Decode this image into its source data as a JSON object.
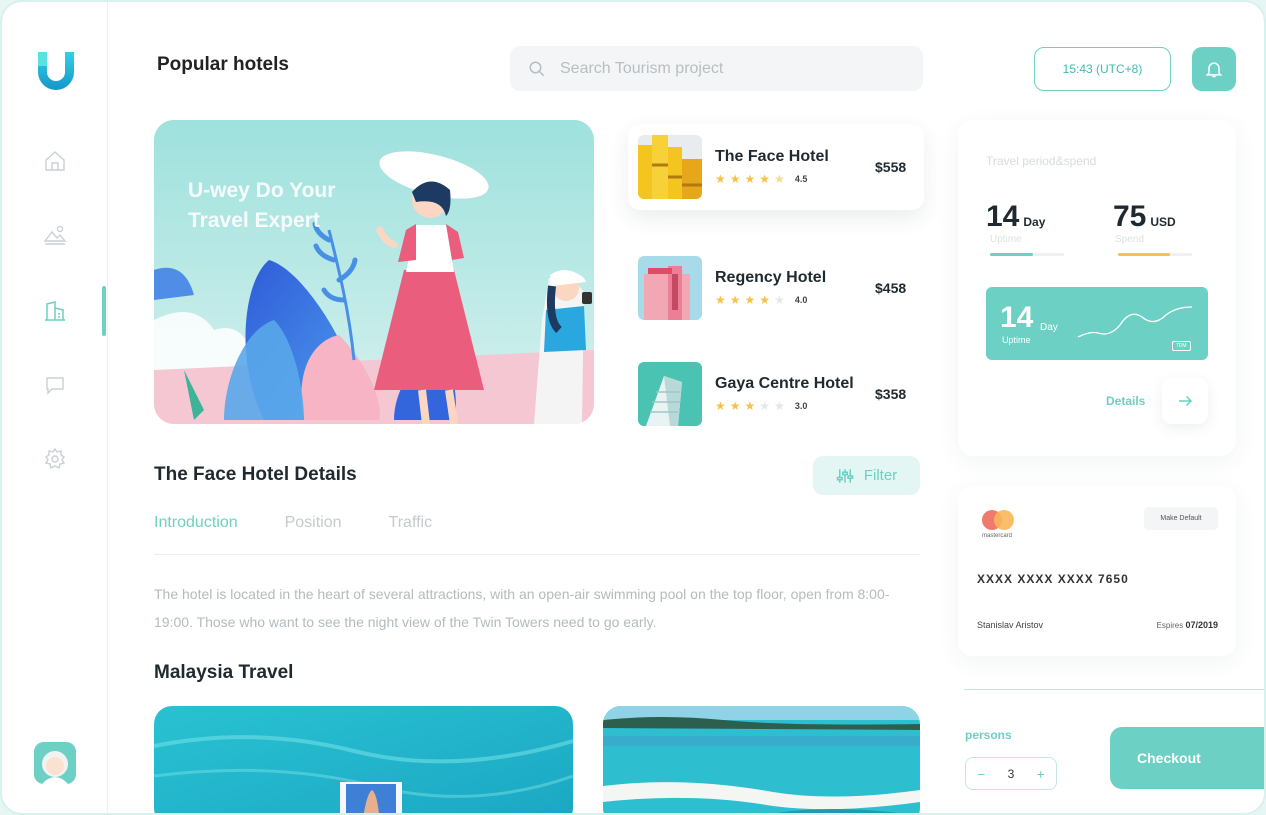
{
  "header": {
    "title": "Popular hotels",
    "search_placeholder": "Search Tourism project",
    "time": "15:43  (UTC+8)"
  },
  "sidebar": {
    "items": [
      {
        "icon": "home-icon"
      },
      {
        "icon": "landscape-icon"
      },
      {
        "icon": "hotel-icon",
        "active": true
      },
      {
        "icon": "chat-icon"
      },
      {
        "icon": "settings-icon"
      }
    ],
    "accent": "#6dd0c4"
  },
  "hero": {
    "headline": "U-wey Do Your Travel Expert"
  },
  "hotels": [
    {
      "name": "The Face Hotel",
      "rating": 4.5,
      "rating_label": "4.5",
      "price": "$558"
    },
    {
      "name": "Regency Hotel",
      "rating": 4.0,
      "rating_label": "4.0",
      "price": "$458"
    },
    {
      "name": "Gaya Centre Hotel",
      "rating": 3.0,
      "rating_label": "3.0",
      "price": "$358"
    }
  ],
  "details": {
    "title": "The Face Hotel Details",
    "filter_label": "Filter",
    "tabs": [
      "Introduction",
      "Position",
      "Traffic"
    ],
    "active_tab": 0,
    "description": "The hotel is located in the heart of several attractions, with an open-air swimming pool on the top floor, open from 8:00-19:00. Those who want to see the night view of the Twin Towers need to go early."
  },
  "travel": {
    "title": "Malaysia Travel"
  },
  "stats": {
    "title": "Travel period&spend",
    "uptime_value": "14",
    "uptime_unit": "Day",
    "uptime_label": "Uptime",
    "spend_value": "75",
    "spend_unit": "USD",
    "spend_label": "Spend",
    "uptime_progress": 0.58,
    "spend_progress": 0.7,
    "box_value": "14",
    "box_unit": "Day",
    "box_label": "Uptime",
    "box_tag": "7DM",
    "details_label": "Details"
  },
  "payment": {
    "brand": "mastercard",
    "make_default": "Make Default",
    "card_number": "XXXX XXXX XXXX 7650",
    "holder": "Stanislav Aristov",
    "expiry_label": "Espires",
    "expiry": "07/2019"
  },
  "booking": {
    "persons_label": "persons",
    "quantity": "3",
    "checkout_label": "Checkout"
  }
}
